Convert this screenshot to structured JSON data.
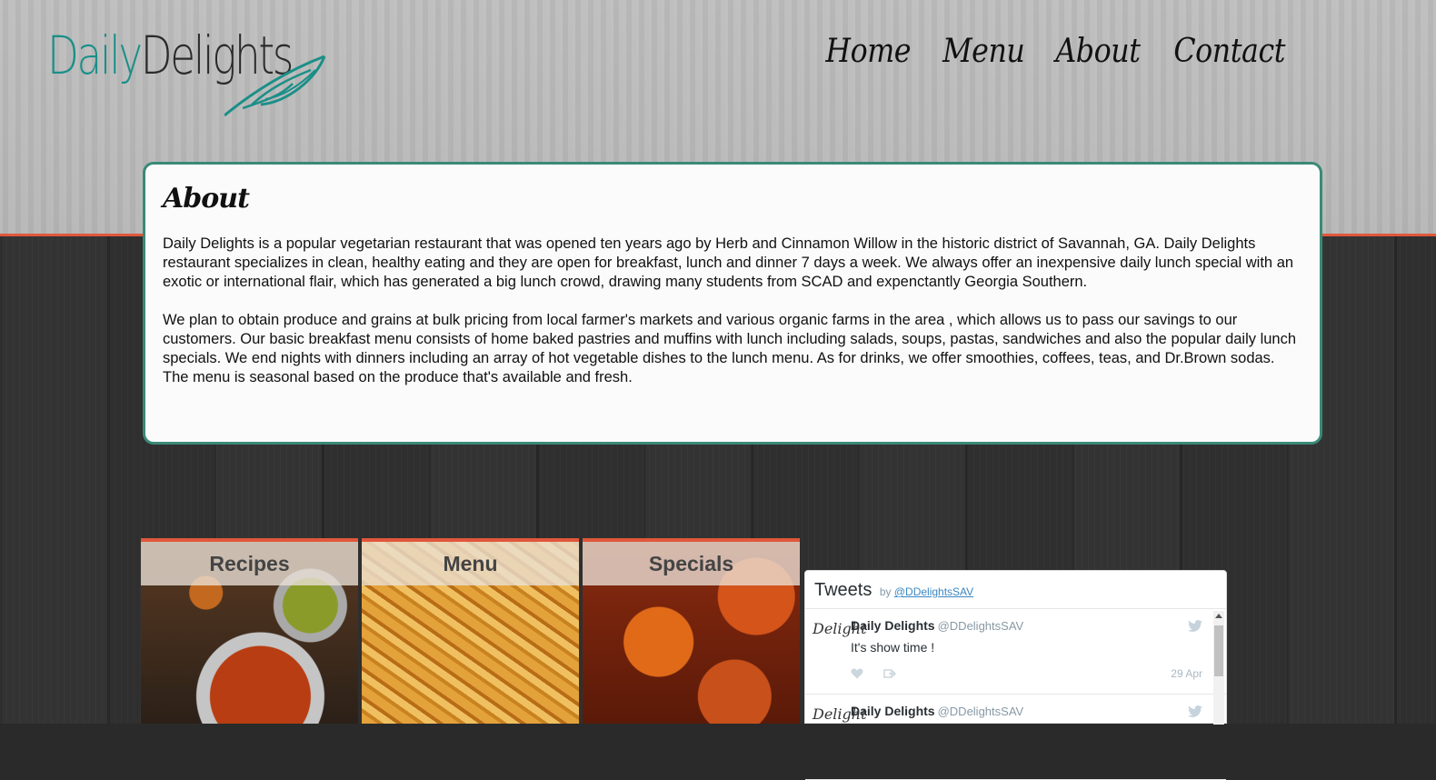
{
  "brand": {
    "name_part1": "Daily",
    "name_part2": "Delights",
    "accent": "#1a8f88",
    "orange": "#e0573b"
  },
  "nav": {
    "items": [
      "Home",
      "Menu",
      "About",
      "Contact"
    ]
  },
  "about": {
    "title": "About",
    "paragraphs": [
      "Daily Delights is a popular vegetarian restaurant that was opened ten years ago by Herb and Cinnamon Willow in the historic district of Savannah, GA. Daily Delights restaurant specializes in clean, healthy eating and they are open for breakfast, lunch and dinner 7 days a week. We always offer an inexpensive daily lunch special with an exotic or international flair, which has generated a big lunch crowd, drawing many students from SCAD and expenctantly Georgia Southern.",
      "We plan to obtain produce and grains at bulk pricing from local farmer's markets and various organic farms in the area , which allows us to pass our savings to our customers. Our basic breakfast menu consists of home baked pastries and muffins with lunch including salads, soups, pastas, sandwiches and also the popular daily lunch specials. We end nights with dinners including an array of hot vegetable dishes to the lunch menu. As for drinks, we offer smoothies, coffees, teas, and Dr.Brown sodas. The menu is seasonal based on the produce that's available and fresh."
    ]
  },
  "tiles": {
    "recipes": "Recipes",
    "menu": "Menu",
    "specials": "Specials"
  },
  "tweets": {
    "title": "Tweets",
    "by": "by",
    "handle": "@DDelightsSAV",
    "items": [
      {
        "avatar": "Delight",
        "name": "Daily Delights",
        "handle": "@DDelightsSAV",
        "text": "It's show time !",
        "date": "29 Apr"
      },
      {
        "avatar": "Delight",
        "name": "Daily Delights",
        "handle": "@DDelightsSAV",
        "text": "",
        "date": ""
      }
    ]
  }
}
